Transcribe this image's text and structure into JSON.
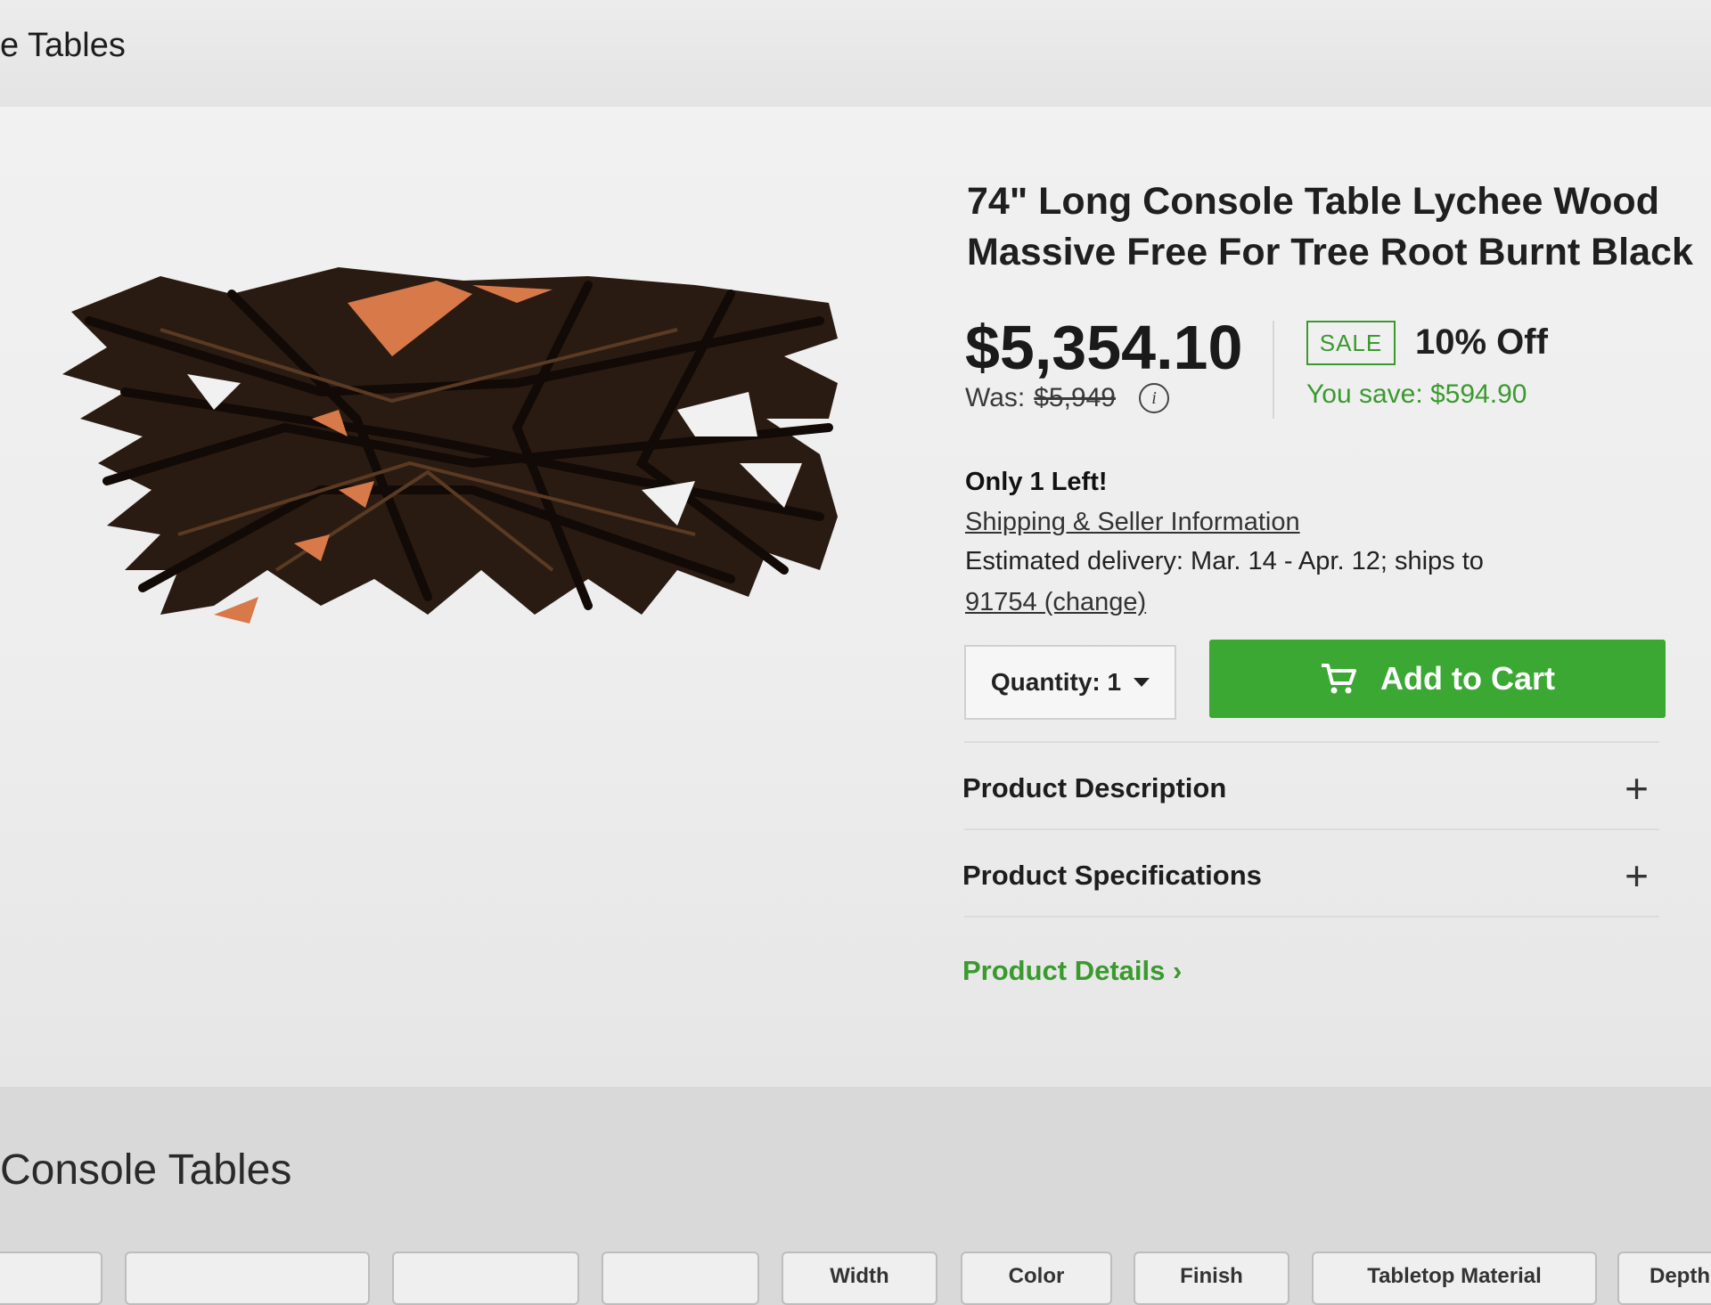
{
  "breadcrumb": {
    "text": "e Tables"
  },
  "product": {
    "title": "74\" Long Console Table Lychee Wood Massive Free For Tree Root Burnt Black",
    "price": "$5,354.10",
    "was_label": "Was:",
    "was_price": "$5,949",
    "sale_badge": "SALE",
    "percent_off": "10% Off",
    "you_save": "You save: $594.90",
    "stock": "Only 1 Left!",
    "shipping_link": "Shipping & Seller Information",
    "delivery": "Estimated delivery: Mar. 14 - Apr. 12; ships to",
    "zip_link": "91754 (change)"
  },
  "purchase": {
    "quantity_label": "Quantity: 1",
    "add_to_cart": "Add to Cart"
  },
  "accordions": [
    {
      "label": "Product Description",
      "icon": "plus-icon"
    },
    {
      "label": "Product Specifications",
      "icon": "plus-icon"
    }
  ],
  "details_link": "Product Details ›",
  "section": {
    "title": "Console Tables"
  },
  "filters": [
    "",
    "",
    "",
    "",
    "Width",
    "Color",
    "Finish",
    "Tabletop Material",
    "Depth"
  ],
  "colors": {
    "accent_green": "#3aa832",
    "link_green": "#3a9a2e"
  }
}
